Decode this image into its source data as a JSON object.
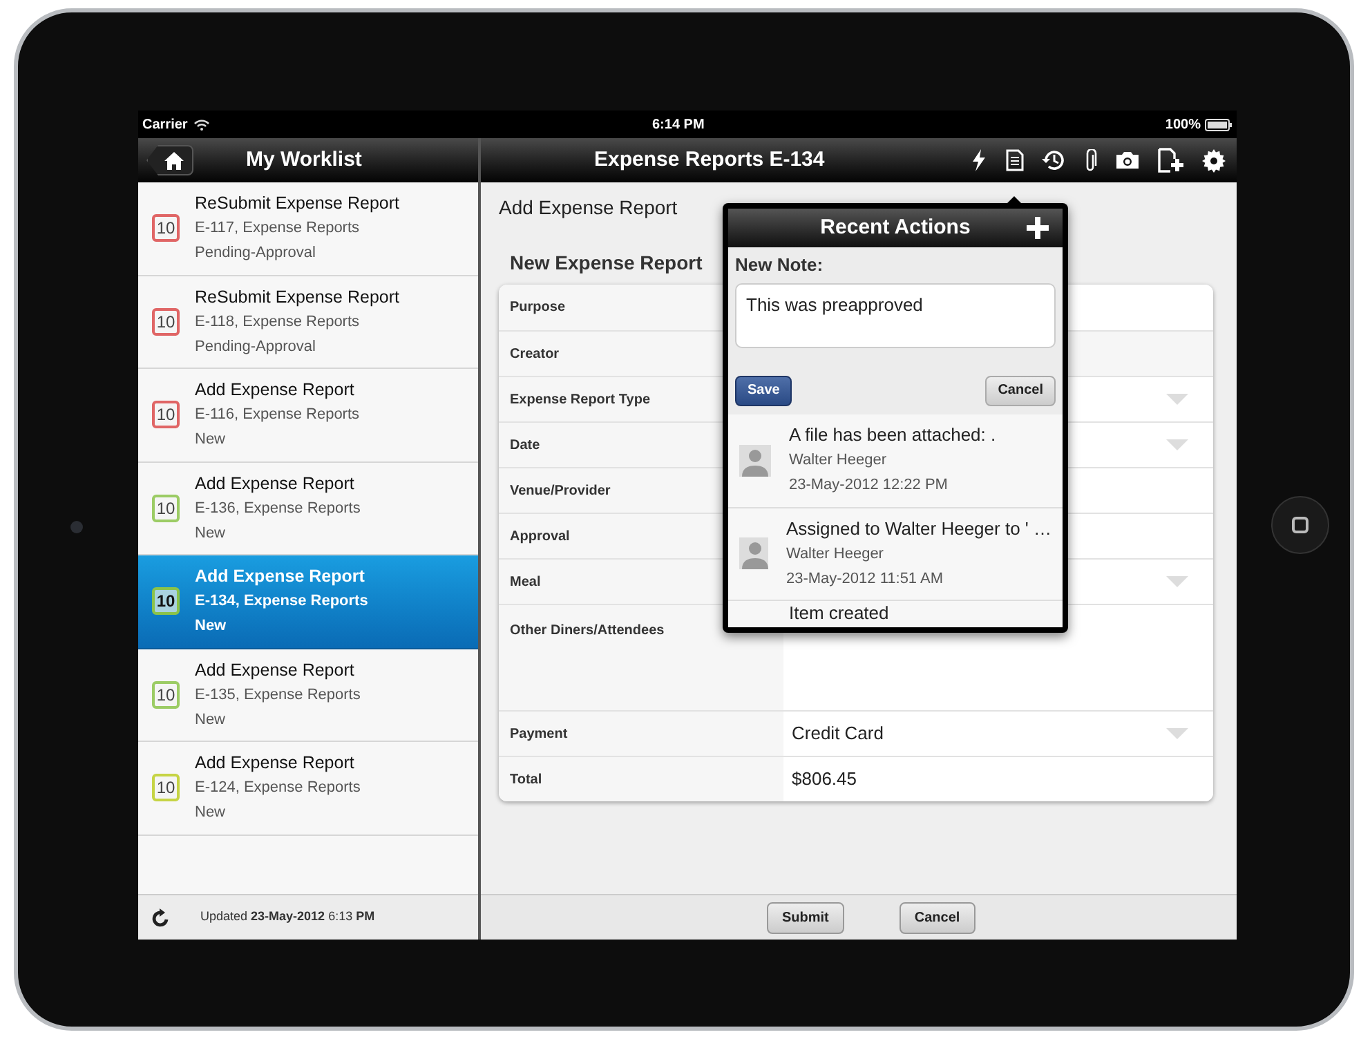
{
  "status_bar": {
    "carrier": "Carrier",
    "time": "6:14 PM",
    "battery": "100%"
  },
  "worklist": {
    "title": "My Worklist",
    "items": [
      {
        "title": "ReSubmit Expense Report",
        "subtitle": "E-117, Expense Reports",
        "status": "Pending-Approval",
        "badge": "10",
        "color": "#e06666",
        "selected": false
      },
      {
        "title": "ReSubmit Expense Report",
        "subtitle": "E-118, Expense Reports",
        "status": "Pending-Approval",
        "badge": "10",
        "color": "#e06666",
        "selected": false
      },
      {
        "title": "Add Expense Report",
        "subtitle": "E-116, Expense Reports",
        "status": "New",
        "badge": "10",
        "color": "#e06666",
        "selected": false
      },
      {
        "title": "Add Expense Report",
        "subtitle": "E-136, Expense Reports",
        "status": "New",
        "badge": "10",
        "color": "#9ccc65",
        "selected": false
      },
      {
        "title": "Add Expense Report",
        "subtitle": "E-134, Expense Reports",
        "status": "New",
        "badge": "10",
        "color": "#8bc34a",
        "selected": true
      },
      {
        "title": "Add Expense Report",
        "subtitle": "E-135, Expense Reports",
        "status": "New",
        "badge": "10",
        "color": "#9ccc65",
        "selected": false
      },
      {
        "title": "Add Expense Report",
        "subtitle": "E-124, Expense Reports",
        "status": "New",
        "badge": "10",
        "color": "#c6d445",
        "selected": false
      }
    ],
    "footer": "Updated **23-May-2012** 6:13 **PM**"
  },
  "detail": {
    "title": "Expense Reports E-134",
    "heading": "Add Expense Report",
    "section": "New Expense Report",
    "fields": [
      {
        "label": "Purpose",
        "kind": "text"
      },
      {
        "label": "Creator",
        "kind": "readonly"
      },
      {
        "label": "Expense Report Type",
        "kind": "select"
      },
      {
        "label": "Date",
        "kind": "select"
      },
      {
        "label": "Venue/Provider",
        "kind": "text"
      },
      {
        "label": "Approval",
        "kind": "text"
      },
      {
        "label": "Meal",
        "kind": "select"
      },
      {
        "label": "Other Diners/Attendees",
        "kind": "textarea"
      },
      {
        "label": "Payment",
        "kind": "select",
        "value": "Credit Card"
      },
      {
        "label": "Total",
        "kind": "text",
        "value": "$806.45"
      }
    ],
    "buttons": [
      "Submit",
      "Cancel"
    ]
  },
  "popover": {
    "title": "Recent Actions",
    "note_label": "New Note:",
    "note_value": "This was preapproved",
    "save": "Save",
    "cancel": "Cancel",
    "actions": [
      {
        "text": "A file has been attached: .",
        "author": "Walter Heeger",
        "time": "23-May-2012 12:22 PM"
      },
      {
        "text": "Assigned to Walter Heeger to ' …",
        "author": "Walter Heeger",
        "time": "23-May-2012 11:51 AM"
      },
      {
        "text": "Item created"
      }
    ]
  }
}
